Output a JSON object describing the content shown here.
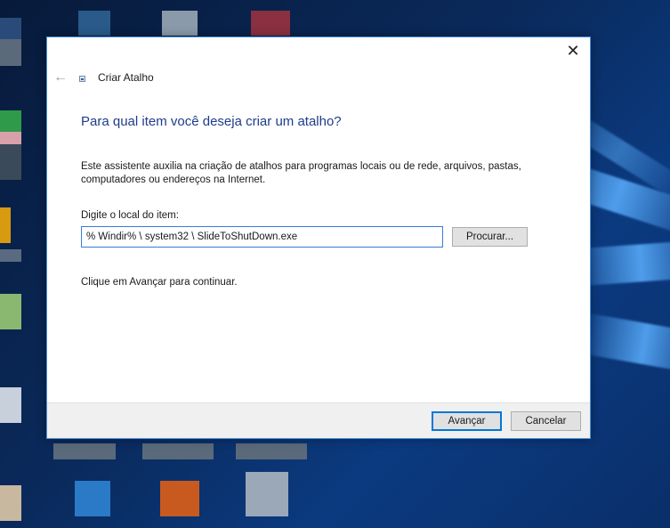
{
  "desktop": {
    "wallpaper": "windows-10-hero",
    "accent_color": "#1e78d7",
    "icons": [
      {
        "name": "desktop-icon-1"
      },
      {
        "name": "desktop-icon-2"
      },
      {
        "name": "desktop-icon-3"
      },
      {
        "name": "desktop-icon-4"
      },
      {
        "name": "desktop-icon-5"
      },
      {
        "name": "desktop-icon-6"
      }
    ]
  },
  "dialog": {
    "title": "Criar Atalho",
    "close_glyph": "✕",
    "back_glyph": "←",
    "heading": "Para qual item você deseja criar um atalho?",
    "description": "Este assistente auxilia na criação de atalhos para programas locais ou de rede, arquivos, pastas, computadores ou endereços na Internet.",
    "field_label": "Digite o local do item:",
    "location_value": "% Windir% \\ system32 \\ SlideToShutDown.exe",
    "browse_label": "Procurar...",
    "hint": "Clique em Avançar para continuar.",
    "next_label": "Avançar",
    "cancel_label": "Cancelar",
    "heading_color": "#1e3c8c",
    "default_button_border": "#0078d7"
  }
}
